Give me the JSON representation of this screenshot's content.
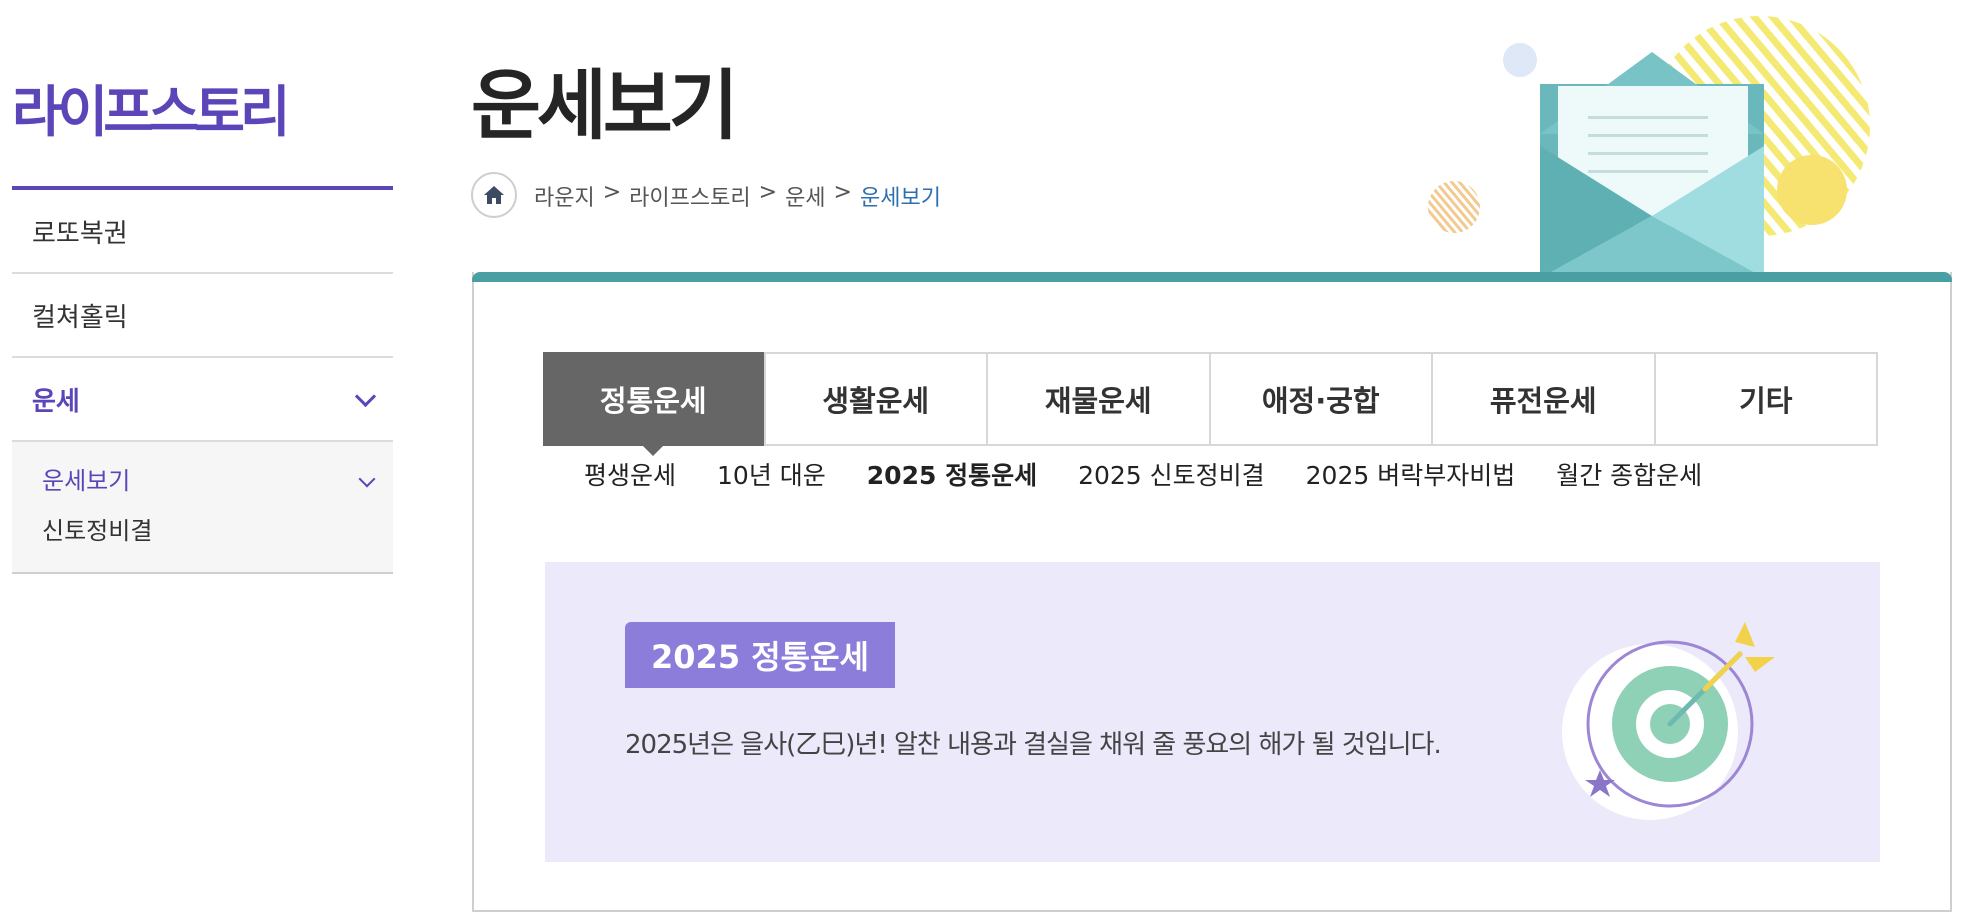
{
  "sidebar": {
    "title": "라이프스토리",
    "items": [
      {
        "label": "로또복권"
      },
      {
        "label": "컬쳐홀릭"
      },
      {
        "label": "운세"
      }
    ],
    "subitems": [
      {
        "label": "운세보기"
      },
      {
        "label": "신토정비결"
      }
    ]
  },
  "header": {
    "title": "운세보기",
    "breadcrumb": [
      "라운지",
      ">",
      "라이프스토리",
      ">",
      "운세",
      ">",
      "운세보기"
    ]
  },
  "tabs": [
    "정통운세",
    "생활운세",
    "재물운세",
    "애정·궁합",
    "퓨전운세",
    "기타"
  ],
  "subtabs": [
    "평생운세",
    "10년 대운",
    "2025 정통운세",
    "2025 신토정비결",
    "2025 벼락부자비법",
    "월간 종합운세"
  ],
  "banner": {
    "badge": "2025 정통운세",
    "text": "2025년은 을사(乙巳)년! 알찬 내용과 결실을 채워 줄 풍요의 해가 될 것입니다."
  },
  "colors": {
    "brand_purple": "#5b45b8",
    "teal": "#4a9fa3",
    "active_tab": "#666666",
    "banner_bg": "#ece9fa",
    "badge": "#8c7ddb",
    "breadcrumb_current": "#2e6fb0"
  },
  "icons": [
    "home-icon",
    "chevron-down-icon",
    "envelope-illustration",
    "target-illustration"
  ]
}
